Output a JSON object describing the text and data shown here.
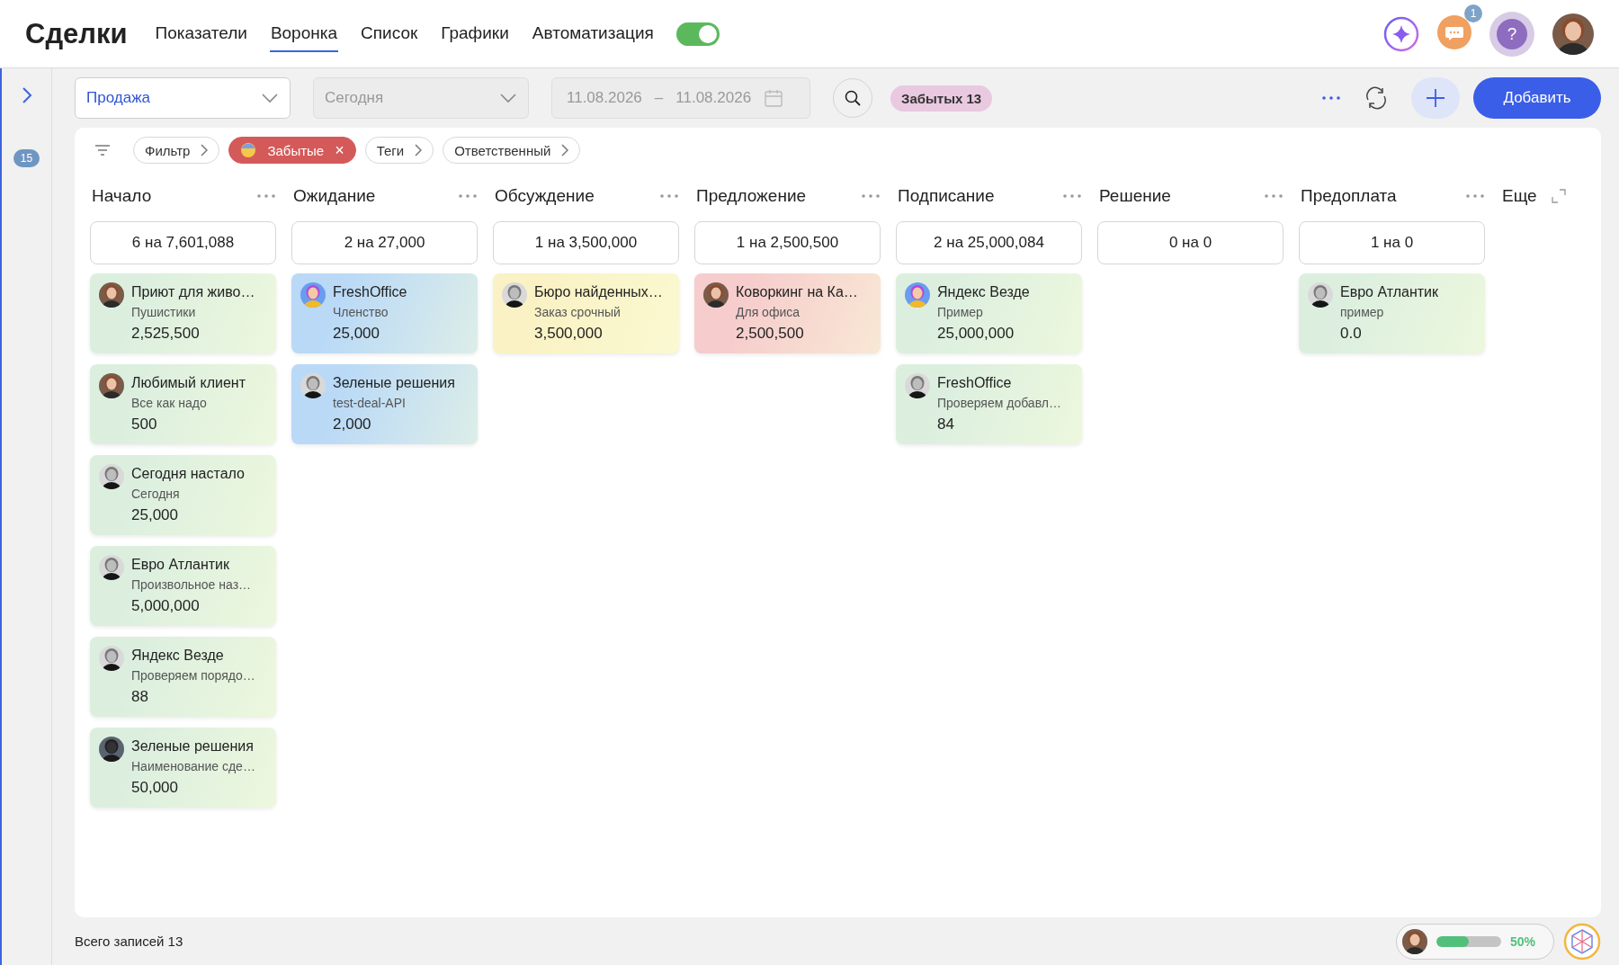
{
  "header": {
    "title": "Сделки",
    "tabs": [
      {
        "label": "Показатели",
        "selected": false
      },
      {
        "label": "Воронка",
        "selected": true
      },
      {
        "label": "Список",
        "selected": false
      },
      {
        "label": "Графики",
        "selected": false
      },
      {
        "label": "Автоматизация",
        "selected": false
      }
    ],
    "automation_toggle": {
      "on": true
    },
    "chat_badge": "1",
    "help_label": "?"
  },
  "sidebar": {
    "badge": "15"
  },
  "toolbar": {
    "pipeline": {
      "value": "Продажа",
      "disabled": false
    },
    "period": {
      "value": "Сегодня",
      "disabled": true
    },
    "date_from": "11.08.2026",
    "date_separator": "–",
    "date_to": "11.08.2026",
    "forgotten_chip": "Забытых 13",
    "add_button": "Добавить"
  },
  "filters": [
    {
      "label": "Фильтр",
      "active": false
    },
    {
      "label": "Забытые",
      "active": true,
      "remove": "×"
    },
    {
      "label": "Теги",
      "active": false
    },
    {
      "label": "Ответственный",
      "active": false
    }
  ],
  "columns": [
    {
      "kind": "stage",
      "title": "Начало",
      "summary": "6 на 7,601,088",
      "cards": [
        {
          "title": "Приют для живо…",
          "subtitle": "Пушистики",
          "amount": "2,525,500",
          "color": "#dcefdf",
          "kind": "woman"
        },
        {
          "title": "Любимый клиент",
          "subtitle": "Все как надо",
          "amount": "500",
          "color": "#dcefdf",
          "kind": "woman"
        },
        {
          "title": "Сегодня настало",
          "subtitle": "Сегодня",
          "amount": "25,000",
          "color": "#dcefdf",
          "kind": "man"
        },
        {
          "title": "Евро Атлантик",
          "subtitle": "Произвольное наз…",
          "amount": "5,000,000",
          "color": "#dcefdf",
          "kind": "man"
        },
        {
          "title": "Яндекс Везде",
          "subtitle": "Проверяем порядо…",
          "amount": "88",
          "color": "#dcefdf",
          "kind": "man"
        },
        {
          "title": "Зеленые решения",
          "subtitle": "Наименование сде…",
          "amount": "50,000",
          "color": "#dcefdf",
          "kind": "dark"
        }
      ]
    },
    {
      "kind": "stage",
      "title": "Ожидание",
      "summary": "2 на 27,000",
      "cards": [
        {
          "title": "FreshOffice",
          "subtitle": "Членство",
          "amount": "25,000",
          "color": "#b9d9f7",
          "kind": "cartoon"
        },
        {
          "title": "Зеленые решения",
          "subtitle": "test-deal-API",
          "amount": "2,000",
          "color": "#b9d9f7",
          "kind": "man"
        }
      ]
    },
    {
      "kind": "stage",
      "title": "Обсуждение",
      "summary": "1 на 3,500,000",
      "cards": [
        {
          "title": "Бюро найденных…",
          "subtitle": "Заказ срочный",
          "amount": "3,500,000",
          "color": "#faf2c4",
          "kind": "man"
        }
      ]
    },
    {
      "kind": "stage",
      "title": "Предложение",
      "summary": "1 на 2,500,500",
      "cards": [
        {
          "title": "Коворкинг на Ка…",
          "subtitle": "Для офиса",
          "amount": "2,500,500",
          "color": "#f6cccc",
          "kind": "woman"
        }
      ]
    },
    {
      "kind": "stage",
      "title": "Подписание",
      "summary": "2 на 25,000,084",
      "cards": [
        {
          "title": "Яндекс Везде",
          "subtitle": "Пример",
          "amount": "25,000,000",
          "color": "#dcefdf",
          "kind": "cartoon"
        },
        {
          "title": "FreshOffice",
          "subtitle": "Проверяем добавл…",
          "amount": "84",
          "color": "#dcefdf",
          "kind": "man"
        }
      ]
    },
    {
      "kind": "stage",
      "title": "Решение",
      "summary": "0 на 0"
    },
    {
      "kind": "stage",
      "title": "Предоплата",
      "summary": "1 на 0",
      "cards": [
        {
          "title": "Евро Атлантик",
          "subtitle": "пример",
          "amount": "0.0",
          "color": "#dcefdf",
          "kind": "man"
        }
      ]
    },
    {
      "kind": "more",
      "title": "Еще"
    }
  ],
  "footer": {
    "total": "Всего записей 13",
    "progress": {
      "level": 0.5,
      "reading": "50%"
    }
  }
}
